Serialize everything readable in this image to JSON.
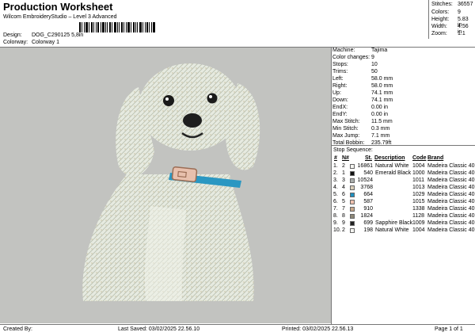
{
  "header": {
    "title": "Production Worksheet",
    "subtitle": "Wilcom EmbroideryStudio – Level 3 Advanced"
  },
  "design_meta": {
    "design_label": "Design:",
    "design_value": "DOG_C290125 5,8in",
    "colorway_label": "Colorway:",
    "colorway_value": "Colorway 1"
  },
  "stats": {
    "stitches_label": "Stitches:",
    "stitches": "36557",
    "colors_label": "Colors:",
    "colors": "9",
    "height_label": "Height:",
    "height": "5.83 in",
    "width_label": "Width:",
    "width": "4.56 in",
    "zoom_label": "Zoom:",
    "zoom": "1:1"
  },
  "machine_info": [
    {
      "label": "Machine:",
      "value": "Tajima"
    },
    {
      "label": "Color changes:",
      "value": "9"
    },
    {
      "label": "Stops:",
      "value": "10"
    },
    {
      "label": "Trims:",
      "value": "50"
    },
    {
      "label": "Left:",
      "value": "58.0 mm"
    },
    {
      "label": "Right:",
      "value": "58.0 mm"
    },
    {
      "label": "Up:",
      "value": "74.1 mm"
    },
    {
      "label": "Down:",
      "value": "74.1 mm"
    },
    {
      "label": "EndX:",
      "value": "0.00 in"
    },
    {
      "label": "EndY:",
      "value": "0.00 in"
    },
    {
      "label": "Max Stitch:",
      "value": "11.5 mm"
    },
    {
      "label": "Min Stitch:",
      "value": "0.3 mm"
    },
    {
      "label": "Max Jump:",
      "value": "7.1 mm"
    },
    {
      "label": "Total Bobbin:",
      "value": "235.79ft"
    }
  ],
  "stop_sequence": {
    "heading": "Stop Sequence:",
    "headers": {
      "num": "#",
      "n": "N#",
      "st": "St.",
      "desc": "Description",
      "code": "Code",
      "brand": "Brand"
    },
    "rows": [
      {
        "num": "1.",
        "n": "2",
        "color": "#f4f4f0",
        "st": "16861",
        "desc": "Natural White",
        "code": "1004",
        "brand": "Madeira Classic 40"
      },
      {
        "num": "2.",
        "n": "1",
        "color": "#111111",
        "st": "540",
        "desc": "Emerald Black",
        "code": "1000",
        "brand": "Madeira Classic 40"
      },
      {
        "num": "3.",
        "n": "3",
        "color": "#a9adab",
        "st": "10524",
        "desc": "",
        "code": "1011",
        "brand": "Madeira Classic 40"
      },
      {
        "num": "4.",
        "n": "4",
        "color": "#d8cdb8",
        "st": "3768",
        "desc": "",
        "code": "1013",
        "brand": "Madeira Classic 40"
      },
      {
        "num": "5.",
        "n": "6",
        "color": "#1f8fbf",
        "st": "664",
        "desc": "",
        "code": "1029",
        "brand": "Madeira Classic 40"
      },
      {
        "num": "6.",
        "n": "5",
        "color": "#f0c2b0",
        "st": "587",
        "desc": "",
        "code": "1015",
        "brand": "Madeira Classic 40"
      },
      {
        "num": "7.",
        "n": "7",
        "color": "#c7a88a",
        "st": "910",
        "desc": "",
        "code": "1338",
        "brand": "Madeira Classic 40"
      },
      {
        "num": "8.",
        "n": "8",
        "color": "#8e8878",
        "st": "1824",
        "desc": "",
        "code": "1128",
        "brand": "Madeira Classic 40"
      },
      {
        "num": "9.",
        "n": "9",
        "color": "#222222",
        "st": "699",
        "desc": "Sapphire Black",
        "code": "1009",
        "brand": "Madeira Classic 40"
      },
      {
        "num": "10.",
        "n": "2",
        "color": "#f4f4f0",
        "st": "198",
        "desc": "Natural White",
        "code": "1004",
        "brand": "Madeira Classic 40"
      }
    ]
  },
  "footer": {
    "created_by": "Created By:",
    "last_saved": "Last Saved: 03/02/2025 22.56.10",
    "printed": "Printed: 03/02/2025 22.56.13",
    "page": "Page 1 of 1"
  }
}
